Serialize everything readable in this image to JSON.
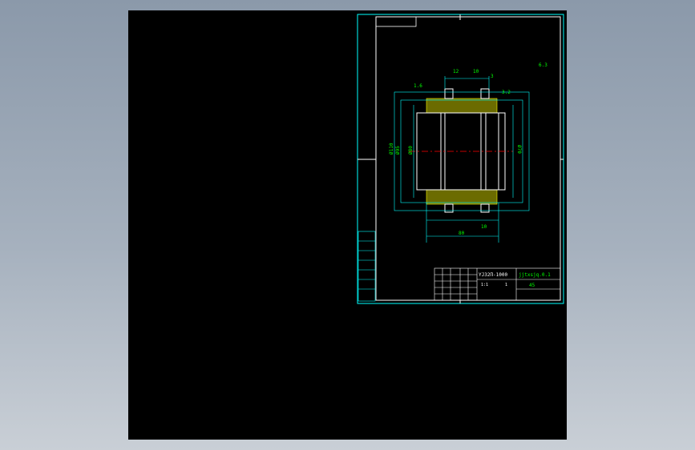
{
  "colors": {
    "background": "#000000",
    "frame": "#00ffff",
    "outline": "#ffffff",
    "dimension": "#00ff00",
    "centerline": "#ff0000",
    "hatch": "#ffff00"
  },
  "titleblock": {
    "name": "YJ32Π-1000",
    "drawing_no": "jjtxsjq.0.1",
    "material": "45",
    "scale": "1:1",
    "sheet": "1"
  },
  "side_table": {
    "cells": [
      "",
      "",
      "",
      "",
      "",
      "",
      ""
    ]
  },
  "dimensions": {
    "bore": "Ø110",
    "outer_left": "Ø95",
    "outer_right": "Ø70",
    "inner_left": "Ø80",
    "length": "80",
    "shoulder": "10",
    "keyway": "12",
    "width_a": "10",
    "width_b": "3"
  },
  "roughness": {
    "default": "6.3",
    "top": "1.6",
    "side": "3.2"
  }
}
